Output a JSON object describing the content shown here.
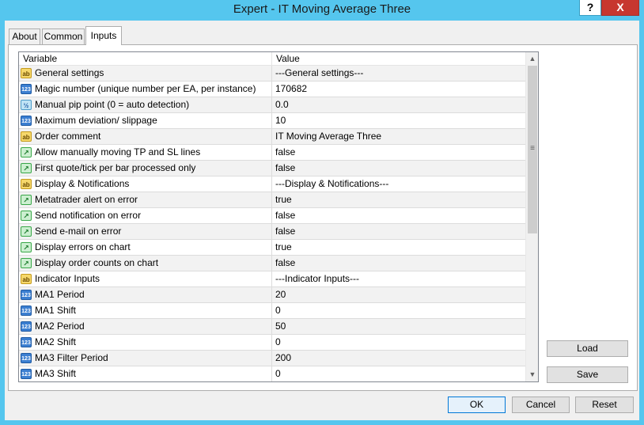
{
  "window": {
    "title": "Expert - IT Moving Average Three",
    "help_label": "?",
    "close_label": "X"
  },
  "tabs": [
    {
      "label": "About"
    },
    {
      "label": "Common"
    },
    {
      "label": "Inputs",
      "active": true
    }
  ],
  "grid": {
    "headers": {
      "variable": "Variable",
      "value": "Value"
    },
    "rows": [
      {
        "icon": "ab",
        "variable": "General settings",
        "value": "---General settings---"
      },
      {
        "icon": "123",
        "variable": "Magic number (unique number per EA, per instance)",
        "value": "170682"
      },
      {
        "icon": "1/2",
        "variable": "Manual pip point (0 = auto detection)",
        "value": "0.0"
      },
      {
        "icon": "123",
        "variable": "Maximum deviation/ slippage",
        "value": "10"
      },
      {
        "icon": "ab",
        "variable": "Order comment",
        "value": "IT Moving Average Three"
      },
      {
        "icon": "bool",
        "variable": "Allow manually moving TP and SL lines",
        "value": "false"
      },
      {
        "icon": "bool",
        "variable": "First quote/tick per bar processed only",
        "value": "false"
      },
      {
        "icon": "ab",
        "variable": "Display & Notifications",
        "value": "---Display & Notifications---"
      },
      {
        "icon": "bool",
        "variable": "Metatrader alert on error",
        "value": "true"
      },
      {
        "icon": "bool",
        "variable": "Send notification on error",
        "value": "false"
      },
      {
        "icon": "bool",
        "variable": "Send e-mail on error",
        "value": "false"
      },
      {
        "icon": "bool",
        "variable": "Display errors on chart",
        "value": "true"
      },
      {
        "icon": "bool",
        "variable": "Display order counts on chart",
        "value": "false"
      },
      {
        "icon": "ab",
        "variable": "Indicator Inputs",
        "value": "---Indicator Inputs---"
      },
      {
        "icon": "123",
        "variable": "MA1 Period",
        "value": "20"
      },
      {
        "icon": "123",
        "variable": "MA1 Shift",
        "value": "0"
      },
      {
        "icon": "123",
        "variable": "MA2 Period",
        "value": "50"
      },
      {
        "icon": "123",
        "variable": "MA2 Shift",
        "value": "0"
      },
      {
        "icon": "123",
        "variable": "MA3 Filter Period",
        "value": "200"
      },
      {
        "icon": "123",
        "variable": "MA3 Shift",
        "value": "0"
      }
    ]
  },
  "side_buttons": {
    "load": "Load",
    "save": "Save"
  },
  "footer_buttons": {
    "ok": "OK",
    "cancel": "Cancel",
    "reset": "Reset"
  },
  "colors": {
    "titlebar": "#55c6ee",
    "close": "#c7372f",
    "default_button_border": "#0078d7"
  }
}
